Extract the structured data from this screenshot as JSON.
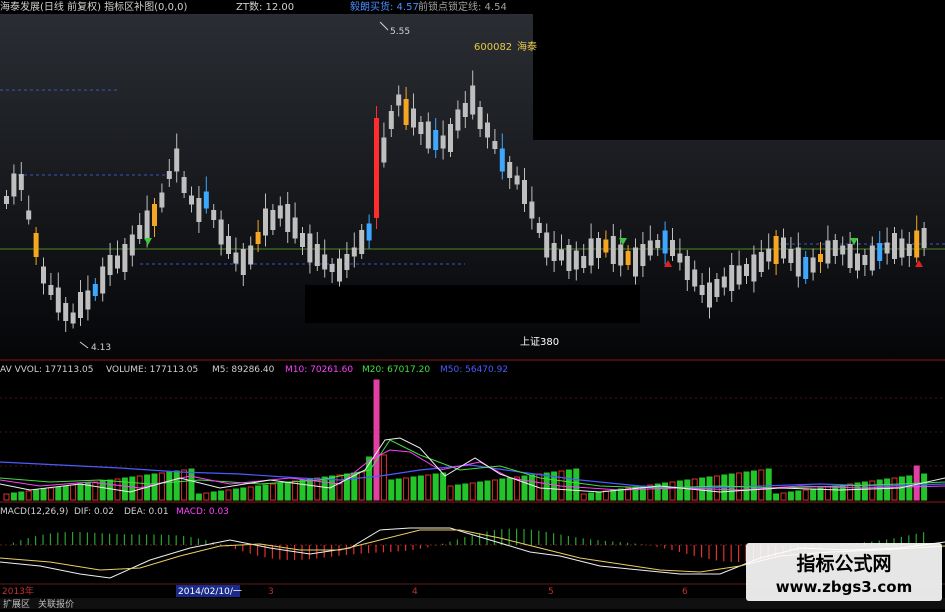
{
  "top_bar": {
    "title": "海泰发展(日线 前复权) 指标区补图(0,0,0)",
    "zt_label": "ZT数: 12.00",
    "lock_label": "毅朗买货: 4.57",
    "trend_label": "前锁点锁定线: 4.54"
  },
  "price_panel": {
    "stock_code": "600082",
    "stock_name_partial": "海泰",
    "high_label": "5.55",
    "low_label": "4.13",
    "index_label": "上证380"
  },
  "volume_panel": {
    "av_vvol": "AV VVOL: 177113.05",
    "volume": "VOLUME: 177113.05",
    "m5": "M5: 89286.40",
    "m10": "M10: 70261.60",
    "m20": "M20: 67017.20",
    "m50": "M50: 56470.92"
  },
  "macd_panel": {
    "title": "MACD(12,26,9)",
    "dif": "DIF: 0.02",
    "dea": "DEA: 0.01",
    "macd": "MACD: 0.03"
  },
  "time_axis": {
    "year_label": "2013年",
    "cursor_date": "2014/02/10/一",
    "months": [
      "3",
      "4",
      "5",
      "6"
    ]
  },
  "bottom_tabs": [
    "扩展区",
    "关联报价"
  ],
  "watermark": {
    "line1": "指标公式网",
    "line2": "www.zbgs3.com"
  },
  "colors": {
    "up_candle": "#ff2d2d",
    "down_candle": "#bfbfbf",
    "highlight_candle": "#f5a623",
    "blue_candle": "#3ea8ff",
    "volume_up": "#e03030",
    "volume_down": "#22c42a",
    "volume_spike": "#e040a0",
    "label_yellow": "#e8c84a",
    "label_blue": "#4a8cff",
    "label_magenta": "#ff40ff",
    "label_green": "#40e040"
  }
}
